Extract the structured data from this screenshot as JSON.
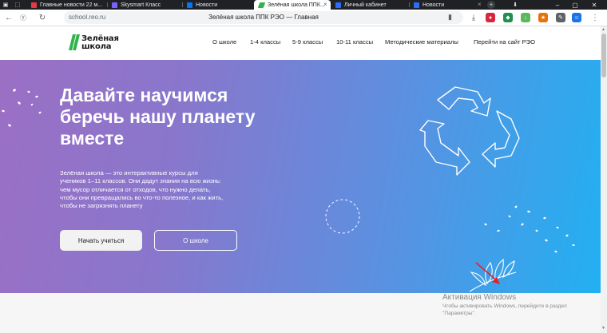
{
  "browser": {
    "tabs": [
      {
        "label": "Главные новости 22 м...",
        "favicon_color": "#e63946"
      },
      {
        "label": "Skysmart Класс",
        "favicon_color": "#7b61ff"
      },
      {
        "label": "Новости",
        "favicon_color": "#0077ff"
      },
      {
        "label": "Зелёная школа ППК...",
        "favicon_color": "#2fb34a",
        "active": true
      },
      {
        "label": "Личный кабинет",
        "favicon_color": "#2b6cff"
      },
      {
        "label": "Новости",
        "favicon_color": "#2b6cff"
      }
    ],
    "url": "school.reo.ru",
    "page_title": "Зелёная школа ППК РЭО — Главная"
  },
  "site": {
    "logo": {
      "line1": "Зелёная",
      "line2": "школа"
    },
    "nav": [
      "О школе",
      "1-4 классы",
      "5-9 классы",
      "10-11 классы",
      "Методические материалы",
      "Перейти на сайт РЭО"
    ]
  },
  "hero": {
    "title_lines": [
      "Давайте научимся",
      "беречь нашу планету",
      "вместе"
    ],
    "description_lines": [
      "Зелёная школа — это интерактивные курсы для",
      "учеников 1–11 классов. Они дадут знания на всю жизнь:",
      "чем мусор отличается от отходов, что нужно делать,",
      "чтобы они превращались во что-то полезное, и как жить,",
      "чтобы не загрязнять планету"
    ],
    "primary_button": "Начать учиться",
    "secondary_button": "О школе"
  },
  "windows_activation": {
    "title": "Активация Windows",
    "subtitle_lines": [
      "Чтобы активировать Windows, перейдите в раздел",
      "\"Параметры\"."
    ]
  },
  "colors": {
    "hero_gradient_start": "#9b6fc4",
    "hero_gradient_end": "#22b0f2",
    "brand_green": "#2fb34a",
    "annotation_arrow": "#e0242a"
  },
  "icons": [
    "recycle-icon",
    "dashed-circle-decoration",
    "leaf-branch-decoration",
    "dots-decoration"
  ]
}
